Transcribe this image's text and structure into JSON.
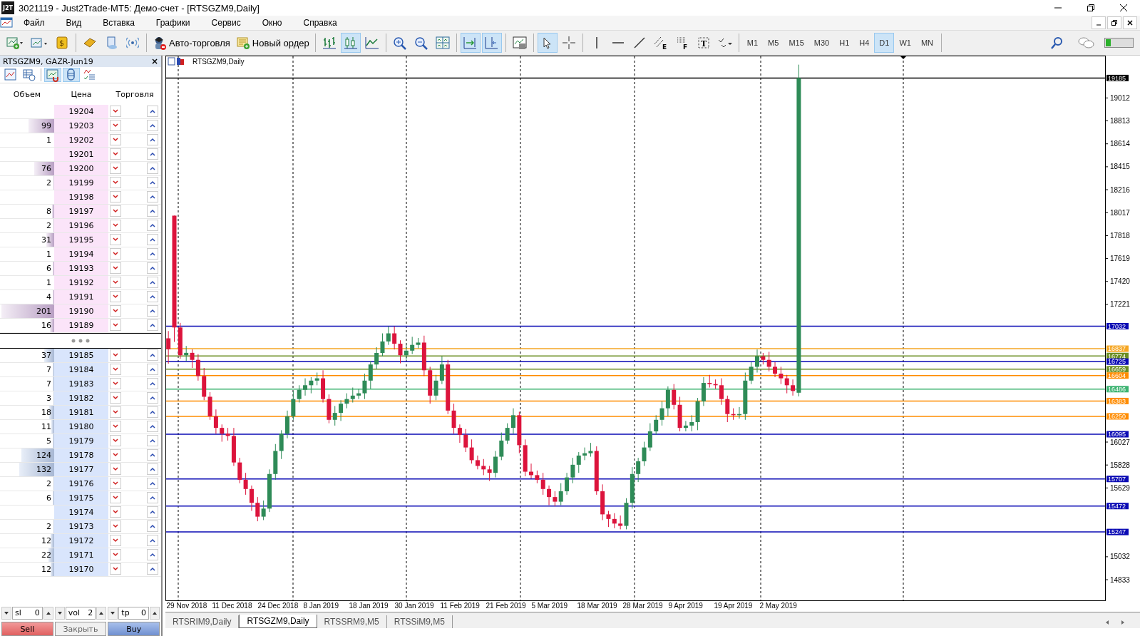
{
  "window": {
    "badge": "J2T",
    "title": "3021119 - Just2Trade-MT5: Демо-счет - [RTSGZM9,Daily]"
  },
  "menu": [
    "Файл",
    "Вид",
    "Вставка",
    "Графики",
    "Сервис",
    "Окно",
    "Справка"
  ],
  "toolbar": [
    {
      "kind": "icon",
      "pressed": false
    },
    {
      "kind": "icon",
      "pressed": false
    },
    {
      "kind": "icon",
      "pressed": false,
      "glyph": "$"
    },
    {
      "kind": "separator"
    },
    {
      "kind": "icon",
      "pressed": false
    },
    {
      "kind": "icon",
      "pressed": false
    },
    {
      "kind": "icon",
      "pressed": false
    },
    {
      "kind": "separator"
    },
    {
      "kind": "button",
      "label": "Авто-торговля"
    },
    {
      "kind": "button",
      "label": "Новый ордер"
    },
    {
      "kind": "separator"
    },
    {
      "kind": "icon",
      "pressed": false
    },
    {
      "kind": "icon",
      "pressed": true
    },
    {
      "kind": "icon",
      "pressed": false
    },
    {
      "kind": "separator"
    },
    {
      "kind": "icon",
      "pressed": false
    },
    {
      "kind": "icon",
      "pressed": false
    },
    {
      "kind": "icon",
      "pressed": false
    },
    {
      "kind": "separator"
    },
    {
      "kind": "icon",
      "pressed": true
    },
    {
      "kind": "icon",
      "pressed": true
    },
    {
      "kind": "separator"
    },
    {
      "kind": "icon",
      "pressed": false
    },
    {
      "kind": "separator"
    },
    {
      "kind": "icon",
      "pressed": true
    },
    {
      "kind": "icon",
      "pressed": false
    },
    {
      "kind": "separator"
    },
    {
      "kind": "icon",
      "pressed": false
    },
    {
      "kind": "icon",
      "pressed": false
    },
    {
      "kind": "icon",
      "pressed": false
    },
    {
      "kind": "icon",
      "pressed": false,
      "glyph": "E"
    },
    {
      "kind": "icon",
      "pressed": false,
      "glyph": "F"
    },
    {
      "kind": "icon",
      "pressed": false,
      "glyph": "T"
    },
    {
      "kind": "icon",
      "pressed": false
    }
  ],
  "timeframes": [
    {
      "label": "M1",
      "selected": false
    },
    {
      "label": "M5",
      "selected": false
    },
    {
      "label": "M15",
      "selected": false
    },
    {
      "label": "M30",
      "selected": false
    },
    {
      "label": "H1",
      "selected": false
    },
    {
      "label": "H4",
      "selected": false
    },
    {
      "label": "D1",
      "selected": true
    },
    {
      "label": "W1",
      "selected": false
    },
    {
      "label": "MN",
      "selected": false
    }
  ],
  "depth_panel": {
    "title": "RTSGZM9, GAZR-Jun19",
    "close": "×",
    "tools": [
      {
        "pressed": false
      },
      {
        "pressed": false
      },
      {
        "pressed": true
      },
      {
        "pressed": true
      },
      {
        "pressed": false
      }
    ],
    "columns": [
      "Объем",
      "Цена",
      "Торговля"
    ],
    "asks": [
      {
        "price": "19204"
      },
      {
        "volume": "99",
        "price": "19203",
        "level": 0.48
      },
      {
        "volume": "1",
        "price": "19202",
        "level": 0.005
      },
      {
        "price": "19201"
      },
      {
        "volume": "76",
        "price": "19200",
        "level": 0.37
      },
      {
        "volume": "2",
        "price": "19199",
        "level": 0.01
      },
      {
        "price": "19198"
      },
      {
        "volume": "8",
        "price": "19197",
        "level": 0.04
      },
      {
        "volume": "2",
        "price": "19196",
        "level": 0.01
      },
      {
        "volume": "31",
        "price": "19195",
        "level": 0.15
      },
      {
        "volume": "1",
        "price": "19194",
        "level": 0.005
      },
      {
        "volume": "6",
        "price": "19193",
        "level": 0.03
      },
      {
        "volume": "1",
        "price": "19192",
        "level": 0.005
      },
      {
        "volume": "4",
        "price": "19191",
        "level": 0.02
      },
      {
        "volume": "201",
        "price": "19190",
        "level": 0.98
      },
      {
        "volume": "16",
        "price": "19189",
        "level": 0.08
      }
    ],
    "bids": [
      {
        "volume": "37",
        "price": "19185",
        "level": 0.18
      },
      {
        "volume": "7",
        "price": "19184",
        "level": 0.03
      },
      {
        "volume": "7",
        "price": "19183",
        "level": 0.03
      },
      {
        "volume": "3",
        "price": "19182",
        "level": 0.01
      },
      {
        "volume": "18",
        "price": "19181",
        "level": 0.09
      },
      {
        "volume": "11",
        "price": "19180",
        "level": 0.05
      },
      {
        "volume": "5",
        "price": "19179",
        "level": 0.02
      },
      {
        "volume": "124",
        "price": "19178",
        "level": 0.6
      },
      {
        "volume": "132",
        "price": "19177",
        "level": 0.64
      },
      {
        "volume": "2",
        "price": "19176",
        "level": 0.01
      },
      {
        "volume": "6",
        "price": "19175",
        "level": 0.03
      },
      {
        "price": "19174"
      },
      {
        "volume": "2",
        "price": "19173",
        "level": 0.01
      },
      {
        "volume": "12",
        "price": "19172",
        "level": 0.06
      },
      {
        "volume": "22",
        "price": "19171",
        "level": 0.11
      },
      {
        "volume": "12",
        "price": "19170",
        "level": 0.06
      }
    ],
    "spinners": [
      {
        "label": "sl",
        "value": "0"
      },
      {
        "label": "vol",
        "value": "2"
      },
      {
        "label": "tp",
        "value": "0"
      }
    ],
    "buttons": [
      {
        "kind": "sell",
        "label": "Sell"
      },
      {
        "kind": "close",
        "label": "Закрыть"
      },
      {
        "kind": "buy",
        "label": "Buy"
      }
    ]
  },
  "chart": {
    "title": "RTSGZM9,Daily",
    "dates": [
      "29 Nov 2018",
      "11 Dec 2018",
      "24 Dec 2018",
      "8 Jan 2019",
      "18 Jan 2019",
      "30 Jan 2019",
      "11 Feb 2019",
      "21 Feb 2019",
      "5 Mar 2019",
      "18 Mar 2019",
      "28 Mar 2019",
      "9 Apr 2019",
      "19 Apr 2019",
      "2 May 2019"
    ],
    "chart_data": {
      "type": "candlestick",
      "ohlc": [
        [
          16927,
          16990,
          16707,
          16832
        ],
        [
          17991,
          17991,
          16896,
          17021
        ],
        [
          17021,
          17061,
          16750,
          16780
        ],
        [
          16780,
          16861,
          16730,
          16801
        ],
        [
          16801,
          16831,
          16670,
          16740
        ],
        [
          16740,
          16790,
          16560,
          16600
        ],
        [
          16600,
          16670,
          16390,
          16420
        ],
        [
          16420,
          16460,
          16220,
          16250
        ],
        [
          16250,
          16310,
          16100,
          16150
        ],
        [
          16150,
          16180,
          16030,
          16100
        ],
        [
          16100,
          16150,
          16040,
          16080
        ],
        [
          16080,
          16150,
          15820,
          15850
        ],
        [
          15850,
          15890,
          15670,
          15700
        ],
        [
          15700,
          15760,
          15570,
          15620
        ],
        [
          15620,
          15650,
          15430,
          15500
        ],
        [
          15500,
          15550,
          15340,
          15380
        ],
        [
          15380,
          15520,
          15350,
          15450
        ],
        [
          15450,
          15790,
          15420,
          15750
        ],
        [
          15750,
          16010,
          15700,
          15950
        ],
        [
          15950,
          16130,
          15880,
          16100
        ],
        [
          16100,
          16300,
          16060,
          16250
        ],
        [
          16250,
          16470,
          16220,
          16400
        ],
        [
          16400,
          16520,
          16370,
          16480
        ],
        [
          16480,
          16580,
          16430,
          16520
        ],
        [
          16520,
          16590,
          16450,
          16560
        ],
        [
          16560,
          16630,
          16520,
          16580
        ],
        [
          16580,
          16650,
          16370,
          16400
        ],
        [
          16400,
          16440,
          16190,
          16220
        ],
        [
          16220,
          16340,
          16170,
          16280
        ],
        [
          16280,
          16390,
          16210,
          16360
        ],
        [
          16360,
          16450,
          16320,
          16400
        ],
        [
          16400,
          16500,
          16370,
          16430
        ],
        [
          16430,
          16490,
          16400,
          16450
        ],
        [
          16450,
          16620,
          16400,
          16560
        ],
        [
          16560,
          16730,
          16490,
          16700
        ],
        [
          16700,
          16850,
          16660,
          16800
        ],
        [
          16800,
          16970,
          16770,
          16900
        ],
        [
          16900,
          17030,
          16870,
          16970
        ],
        [
          16970,
          17030,
          16830,
          16880
        ],
        [
          16880,
          16910,
          16710,
          16780
        ],
        [
          16780,
          16870,
          16740,
          16820
        ],
        [
          16820,
          16940,
          16790,
          16870
        ],
        [
          16870,
          16930,
          16840,
          16890
        ],
        [
          16890,
          16950,
          16600,
          16650
        ],
        [
          16650,
          16680,
          16360,
          16430
        ],
        [
          16430,
          16610,
          16390,
          16560
        ],
        [
          16560,
          16770,
          16530,
          16700
        ],
        [
          16700,
          16740,
          16270,
          16300
        ],
        [
          16300,
          16360,
          16100,
          16150
        ],
        [
          16150,
          16180,
          16020,
          16090
        ],
        [
          16090,
          16140,
          15940,
          15980
        ],
        [
          15980,
          16050,
          15840,
          15870
        ],
        [
          15870,
          15910,
          15790,
          15820
        ],
        [
          15820,
          15880,
          15740,
          15790
        ],
        [
          15790,
          15820,
          15690,
          15760
        ],
        [
          15760,
          15950,
          15720,
          15900
        ],
        [
          15900,
          16110,
          15870,
          16040
        ],
        [
          16040,
          16190,
          16010,
          16150
        ],
        [
          16150,
          16320,
          16100,
          16260
        ],
        [
          16260,
          16290,
          15930,
          16000
        ],
        [
          16000,
          16050,
          15730,
          15770
        ],
        [
          15770,
          15840,
          15710,
          15740
        ],
        [
          15740,
          15780,
          15670,
          15700
        ],
        [
          15700,
          15760,
          15570,
          15620
        ],
        [
          15620,
          15650,
          15480,
          15550
        ],
        [
          15550,
          15600,
          15470,
          15510
        ],
        [
          15510,
          15670,
          15480,
          15600
        ],
        [
          15600,
          15760,
          15570,
          15720
        ],
        [
          15720,
          15890,
          15670,
          15830
        ],
        [
          15830,
          15940,
          15760,
          15910
        ],
        [
          15910,
          15980,
          15870,
          15930
        ],
        [
          15930,
          16020,
          15900,
          15950
        ],
        [
          15950,
          15990,
          15570,
          15600
        ],
        [
          15600,
          15660,
          15350,
          15400
        ],
        [
          15400,
          15430,
          15290,
          15360
        ],
        [
          15360,
          15410,
          15280,
          15320
        ],
        [
          15320,
          15390,
          15270,
          15300
        ],
        [
          15300,
          15540,
          15270,
          15500
        ],
        [
          15500,
          15810,
          15450,
          15750
        ],
        [
          15750,
          15890,
          15680,
          15860
        ],
        [
          15860,
          16030,
          15820,
          15980
        ],
        [
          15980,
          16190,
          15950,
          16120
        ],
        [
          16120,
          16260,
          16090,
          16220
        ],
        [
          16220,
          16380,
          16170,
          16320
        ],
        [
          16320,
          16510,
          16250,
          16480
        ],
        [
          16480,
          16530,
          16310,
          16350
        ],
        [
          16350,
          16420,
          16120,
          16150
        ],
        [
          16150,
          16210,
          16120,
          16170
        ],
        [
          16170,
          16260,
          16120,
          16200
        ],
        [
          16200,
          16410,
          16130,
          16380
        ],
        [
          16380,
          16590,
          16340,
          16540
        ],
        [
          16540,
          16610,
          16500,
          16530
        ],
        [
          16530,
          16570,
          16490,
          16520
        ],
        [
          16520,
          16580,
          16350,
          16400
        ],
        [
          16400,
          16430,
          16200,
          16270
        ],
        [
          16270,
          16320,
          16220,
          16260
        ],
        [
          16260,
          16330,
          16230,
          16270
        ],
        [
          16270,
          16630,
          16220,
          16560
        ],
        [
          16560,
          16720,
          16530,
          16680
        ],
        [
          16680,
          16830,
          16630,
          16770
        ],
        [
          16770,
          16800,
          16700,
          16740
        ],
        [
          16740,
          16810,
          16640,
          16680
        ],
        [
          16680,
          16720,
          16590,
          16620
        ],
        [
          16620,
          16680,
          16530,
          16580
        ],
        [
          16580,
          16610,
          16450,
          16520
        ],
        [
          16520,
          16570,
          16430,
          16470
        ],
        [
          16455,
          19301,
          16423,
          19185
        ],
        null,
        null,
        null,
        null,
        null,
        null,
        null,
        null,
        null,
        null,
        null,
        null,
        null,
        null,
        null,
        null,
        null,
        null,
        null,
        null,
        null,
        null,
        null,
        null,
        null,
        null,
        null,
        null,
        null,
        null,
        null,
        null,
        null,
        null,
        null,
        null,
        null,
        null,
        null,
        null,
        null,
        null,
        null,
        null,
        null,
        null,
        null,
        null,
        null,
        null,
        null
      ],
      "ylim": [
        14654,
        19373
      ],
      "categories": [
        null,
        null,
        null,
        null,
        null,
        null,
        null,
        null,
        null,
        null,
        null,
        null,
        null,
        null,
        null,
        null,
        null,
        null,
        null,
        null,
        null,
        null,
        null,
        null,
        null,
        null,
        null,
        null,
        null,
        null,
        null,
        null,
        null,
        null,
        null,
        null,
        null,
        null,
        null,
        null,
        null,
        null,
        null,
        null,
        null,
        null,
        null,
        null,
        null,
        null,
        null,
        null,
        null,
        null,
        null,
        null,
        null,
        null,
        null,
        null,
        null,
        null,
        null,
        null,
        null,
        null,
        null,
        null,
        null,
        null,
        null,
        null,
        null,
        null,
        null,
        null,
        null,
        null,
        null,
        null,
        null,
        null,
        null,
        null,
        null,
        null,
        null,
        null,
        null,
        null,
        null,
        null,
        null,
        null,
        null,
        null,
        null,
        null,
        null,
        null,
        null,
        null,
        null,
        null,
        null,
        null,
        null,
        null,
        null,
        null,
        null,
        null,
        null,
        null,
        null,
        null,
        null,
        null,
        null,
        null,
        null,
        null,
        null,
        null,
        null,
        null,
        null,
        null,
        null,
        null,
        null,
        null,
        null,
        null,
        null,
        null,
        null,
        null,
        null,
        null,
        null,
        null,
        null,
        null,
        null,
        null,
        null,
        null,
        null,
        null,
        null,
        null,
        null,
        null,
        null,
        null,
        null,
        null
      ],
      "yticks": [
        19012,
        18813,
        18614,
        18415,
        18216,
        18017,
        17818,
        17619,
        17420,
        17221,
        16027,
        15828,
        15629,
        15032,
        14833
      ],
      "ref_lines": [
        {
          "axis": "y",
          "value": 19185,
          "label": "19185",
          "color": "#000000"
        },
        {
          "axis": "y",
          "value": 17032,
          "label": "17032",
          "color": "#0a0ab4"
        },
        {
          "axis": "y",
          "value": 16837,
          "label": "16837",
          "color": "#f5a623"
        },
        {
          "axis": "y",
          "value": 16774,
          "label": "16774",
          "color": "#6b8e23"
        },
        {
          "axis": "y",
          "value": 16725,
          "label": "16725",
          "color": "#0a0ab4"
        },
        {
          "axis": "y",
          "value": 16659,
          "label": "16659",
          "color": "#6b8e23"
        },
        {
          "axis": "y",
          "value": 16604,
          "label": "16604",
          "color": "#ff8c00"
        },
        {
          "axis": "y",
          "value": 16486,
          "label": "16486",
          "color": "#3cb371"
        },
        {
          "axis": "y",
          "value": 16383,
          "label": "16383",
          "color": "#ff8c00"
        },
        {
          "axis": "y",
          "value": 16250,
          "label": "16250",
          "color": "#ff8c00"
        },
        {
          "axis": "y",
          "value": 16095,
          "label": "16095",
          "color": "#0a0ab4"
        },
        {
          "axis": "y",
          "value": 15707,
          "label": "15707",
          "color": "#0a0ab4"
        },
        {
          "axis": "y",
          "value": 15472,
          "label": "15472",
          "color": "#0a0ab4"
        },
        {
          "axis": "y",
          "value": 15247,
          "label": "15247",
          "color": "#0a0ab4"
        }
      ]
    }
  },
  "tabs": [
    {
      "label": "RTSRIM9,Daily",
      "selected": false
    },
    {
      "label": "RTSGZM9,Daily",
      "selected": true
    },
    {
      "label": "RTSSRM9,M5",
      "selected": false
    },
    {
      "label": "RTSSiM9,M5",
      "selected": false
    }
  ]
}
